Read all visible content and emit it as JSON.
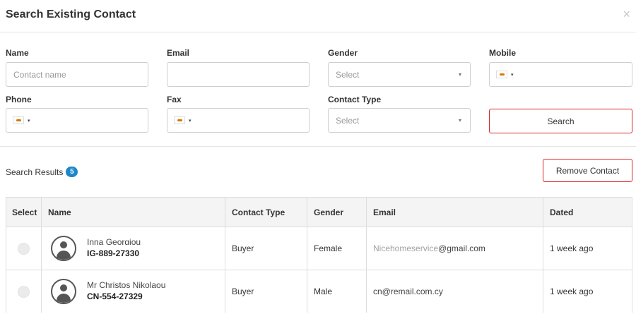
{
  "modal": {
    "title": "Search Existing Contact",
    "close_icon": "×"
  },
  "form": {
    "name_label": "Name",
    "name_placeholder": "Contact name",
    "email_label": "Email",
    "gender_label": "Gender",
    "gender_value": "Select",
    "mobile_label": "Mobile",
    "phone_label": "Phone",
    "fax_label": "Fax",
    "contact_type_label": "Contact Type",
    "contact_type_value": "Select",
    "caret_icon": "▾",
    "search_label": "Search"
  },
  "results": {
    "label": "Search Results",
    "count": "5",
    "remove_label": "Remove Contact"
  },
  "table": {
    "headers": [
      "Select",
      "Name",
      "Contact Type",
      "Gender",
      "Email",
      "Dated"
    ],
    "rows": [
      {
        "name": "Inna Georgiou",
        "code": "IG-889-27330",
        "type": "Buyer",
        "gender": "Female",
        "email_hidden": "Nicehomeservice",
        "email_visible": "@gmail.com",
        "dated": "1 week ago"
      },
      {
        "name": "Mr Christos Nikolaou",
        "code": "CN-554-27329",
        "type": "Buyer",
        "gender": "Male",
        "email": "cn@remail.com.cy",
        "dated": "1 week ago"
      }
    ]
  },
  "colors": {
    "accent_red": "#d9252b",
    "badge_blue": "#1d87c9",
    "header_bg": "#f4f4f4"
  },
  "icons": {
    "close": "close-icon",
    "avatar": "user-avatar-icon",
    "flag": "cyprus-flag-icon"
  }
}
